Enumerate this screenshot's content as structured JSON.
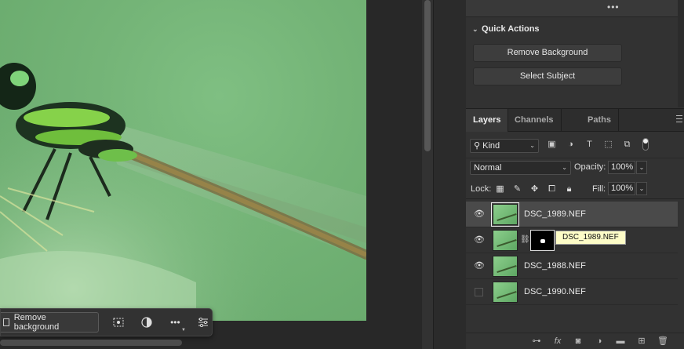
{
  "colors": {
    "accent": "#393939",
    "photo": "#74b477",
    "tooltip_bg": "#fdfcc7"
  },
  "taskbar": {
    "remove_background_label": "Remove background",
    "icons": [
      "select-subject-icon",
      "adjustment-icon",
      "more-icon",
      "settings-icon"
    ]
  },
  "quick_actions": {
    "title": "Quick Actions",
    "buttons": [
      "Remove Background",
      "Select Subject"
    ]
  },
  "tabs": [
    "Layers",
    "Channels",
    "Paths"
  ],
  "filter": {
    "kind_label": "Kind"
  },
  "blend": {
    "mode": "Normal",
    "opacity_label": "Opacity:",
    "opacity_value": "100%"
  },
  "lock": {
    "label": "Lock:",
    "fill_label": "Fill:",
    "fill_value": "100%"
  },
  "layers": [
    {
      "name": "DSC_1989.NEF",
      "visible": true,
      "selected": true,
      "mask": false
    },
    {
      "name": "",
      "visible": true,
      "selected": false,
      "mask": true
    },
    {
      "name": "DSC_1988.NEF",
      "visible": true,
      "selected": false,
      "mask": false
    },
    {
      "name": "DSC_1990.NEF",
      "visible": false,
      "selected": false,
      "mask": false
    }
  ],
  "tooltip": "DSC_1989.NEF",
  "bottom_icons": [
    "link-layers-icon",
    "fx-icon",
    "add-mask-icon",
    "adjustment-layer-icon",
    "group-icon",
    "new-layer-icon",
    "trash-icon"
  ]
}
